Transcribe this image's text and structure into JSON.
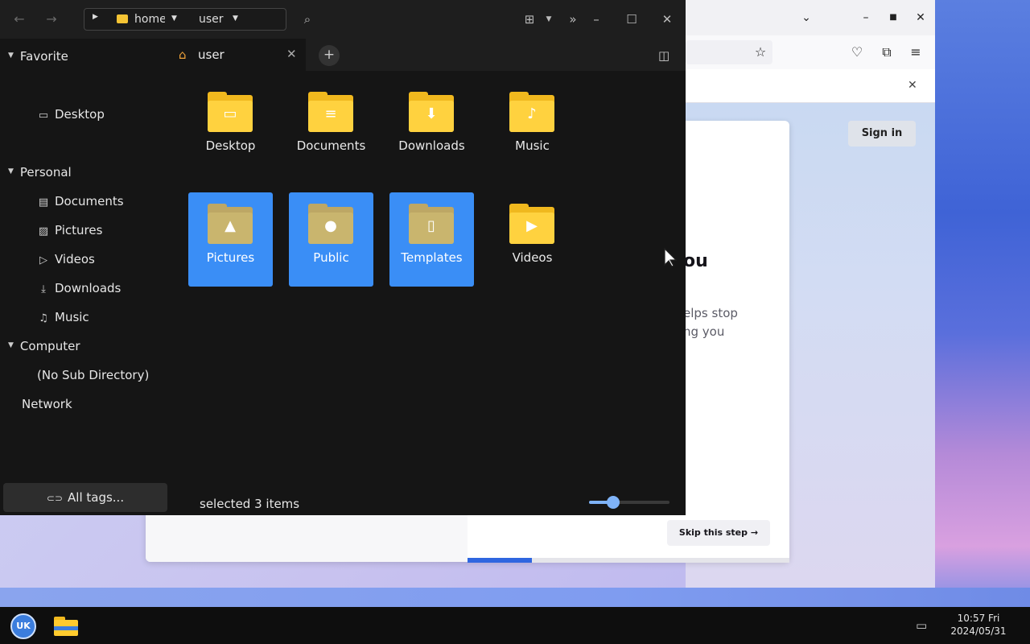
{
  "file_manager": {
    "path": {
      "segment1": "home",
      "segment2": "user"
    },
    "sidebar": {
      "favorite": {
        "label": "Favorite",
        "items": [
          {
            "label": "Desktop",
            "icon": "monitor-icon"
          }
        ]
      },
      "personal": {
        "label": "Personal",
        "items": [
          {
            "label": "Documents",
            "icon": "document-icon"
          },
          {
            "label": "Pictures",
            "icon": "image-icon"
          },
          {
            "label": "Videos",
            "icon": "video-icon"
          },
          {
            "label": "Downloads",
            "icon": "download-icon"
          },
          {
            "label": "Music",
            "icon": "music-icon"
          }
        ]
      },
      "computer": {
        "label": "Computer",
        "items": [
          {
            "label": "(No Sub Directory)"
          }
        ]
      },
      "network": {
        "label": "Network"
      },
      "tags_button": "All tags..."
    },
    "tab": {
      "label": "user"
    },
    "items": [
      {
        "label": "Desktop",
        "glyph": "▭",
        "selected": false
      },
      {
        "label": "Documents",
        "glyph": "≡",
        "selected": false
      },
      {
        "label": "Downloads",
        "glyph": "⬇",
        "selected": false
      },
      {
        "label": "Music",
        "glyph": "♪",
        "selected": false
      },
      {
        "label": "Pictures",
        "glyph": "▲",
        "selected": true
      },
      {
        "label": "Public",
        "glyph": "●",
        "selected": true
      },
      {
        "label": "Templates",
        "glyph": "▯",
        "selected": true
      },
      {
        "label": "Videos",
        "glyph": "▶",
        "selected": false
      }
    ],
    "status": "selected 3 items",
    "zoom_level": 0.3
  },
  "browser": {
    "sign_in": "Sign in",
    "card_title_fragment": "ou",
    "card_body_line1": "elps stop",
    "card_body_line2": "ng you",
    "skip_button": "Skip this step →",
    "onboarding_progress": 0.2
  },
  "taskbar": {
    "start_label": "UK",
    "time": "10:57 Fri",
    "date": "2024/05/31"
  },
  "colors": {
    "selection": "#3a8ef6",
    "folder": "#ffd23f",
    "accent": "#2f66e0"
  }
}
